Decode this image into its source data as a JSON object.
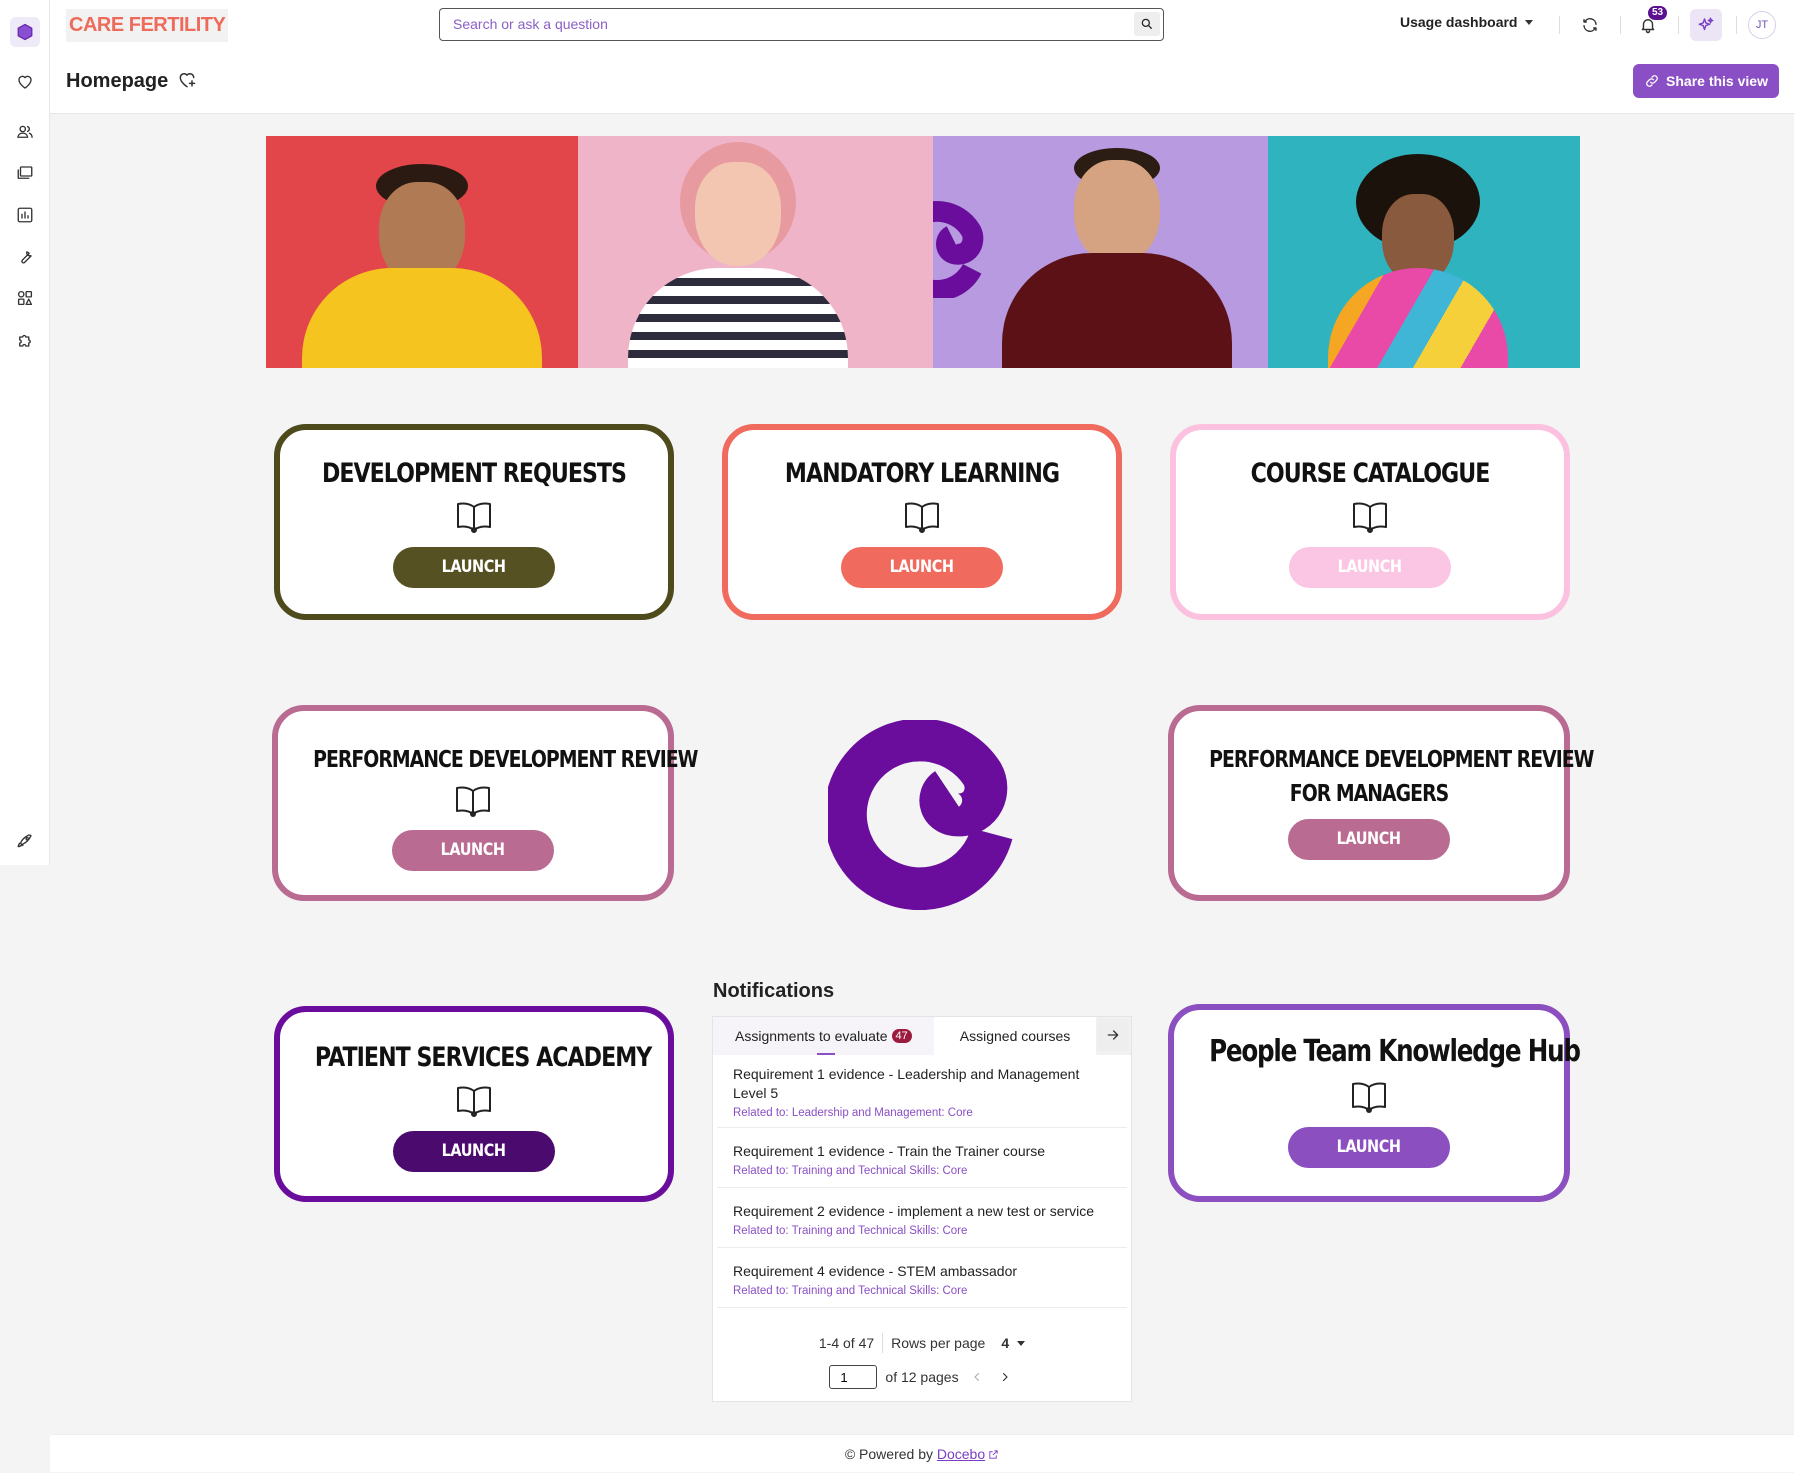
{
  "app": {
    "logo_text": "CARE FERTILITY",
    "search_placeholder": "Search or ask a question",
    "usage_dashboard": "Usage dashboard",
    "notification_count": "53",
    "user_initials": "JT",
    "page_title": "Homepage",
    "share_label": "Share this view"
  },
  "sidebar": {
    "items": [
      {
        "name": "home-cube-icon",
        "active": true
      },
      {
        "name": "heart-icon"
      },
      {
        "name": "users-icon"
      },
      {
        "name": "courses-icon"
      },
      {
        "name": "reports-icon"
      },
      {
        "name": "wrench-icon"
      },
      {
        "name": "apps-icon"
      },
      {
        "name": "puzzle-icon"
      },
      {
        "name": "rocket-icon"
      }
    ]
  },
  "tiles": [
    {
      "title": "DEVELOPMENT REQUESTS",
      "button": "LAUNCH",
      "border": "#4d4a1b",
      "button_color": "#555122"
    },
    {
      "title": "MANDATORY LEARNING",
      "button": "LAUNCH",
      "border": "#f06a5e",
      "button_color": "#f06a5e"
    },
    {
      "title": "COURSE CATALOGUE",
      "button": "LAUNCH",
      "border": "#fbc1de",
      "button_color": "#fbc6e3"
    },
    {
      "title": "PERFORMANCE DEVELOPMENT REVIEW",
      "button": "LAUNCH",
      "border": "#b96b92",
      "button_color": "#b96b92"
    },
    {
      "title_line1": "PERFORMANCE DEVELOPMENT REVIEW",
      "title_line2": "FOR MANAGERS",
      "button": "LAUNCH",
      "border": "#b96b92",
      "button_color": "#b96b92"
    },
    {
      "title": "PATIENT SERVICES ACADEMY",
      "button": "LAUNCH",
      "border": "#6a0d9c",
      "button_color": "#4b0a6e"
    },
    {
      "title": "People Team Knowledge Hub",
      "button": "LAUNCH",
      "border": "#8b4fc0",
      "button_color": "#8b4fc0"
    }
  ],
  "notifications": {
    "title": "Notifications",
    "tab1": "Assignments to evaluate",
    "tab1_count": "47",
    "tab2": "Assigned courses",
    "items": [
      {
        "title": "Requirement 1 evidence - Leadership and Management Level 5",
        "related": "Related to: Leadership and Management: Core"
      },
      {
        "title": "Requirement 1 evidence - Train the Trainer course",
        "related": "Related to: Training and Technical Skills: Core"
      },
      {
        "title": "Requirement 2 evidence - implement a new test or service",
        "related": "Related to: Training and Technical Skills: Core"
      },
      {
        "title": "Requirement 4 evidence - STEM ambassador",
        "related": "Related to: Training and Technical Skills: Core"
      }
    ],
    "range": "1-4 of 47",
    "rows_per_page_label": "Rows per page",
    "rows_per_page": "4",
    "page": "1",
    "of_pages": "of 12 pages"
  },
  "footer": {
    "prefix": "© Powered by",
    "link": "Docebo"
  },
  "colors": {
    "brand_purple": "#6a0d9c",
    "accent": "#8a4fc4",
    "logo_red": "#ee6b5c"
  }
}
